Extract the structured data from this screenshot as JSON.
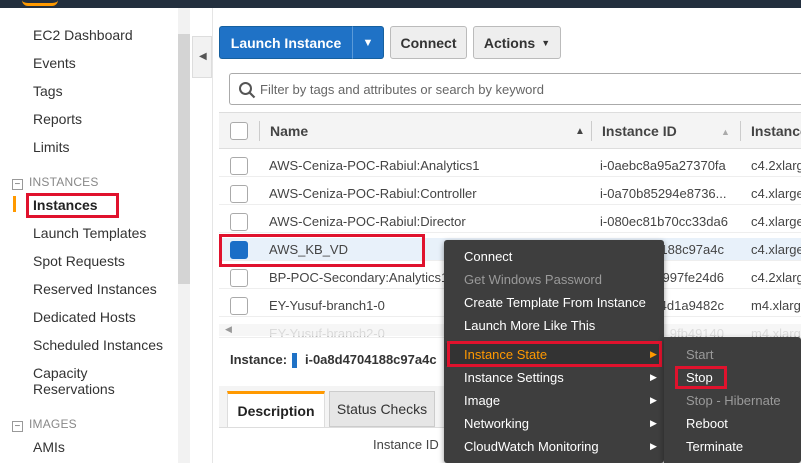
{
  "sidebar": {
    "items_top": [
      "EC2 Dashboard",
      "Events",
      "Tags",
      "Reports",
      "Limits"
    ],
    "section_instances": "INSTANCES",
    "instances_items": [
      "Instances",
      "Launch Templates",
      "Spot Requests",
      "Reserved Instances",
      "Dedicated Hosts",
      "Scheduled Instances",
      "Capacity",
      "Reservations"
    ],
    "section_images": "IMAGES",
    "images_items": [
      "AMIs"
    ],
    "collapse_glyph": "−"
  },
  "toolbar": {
    "launch_label": "Launch Instance",
    "connect_label": "Connect",
    "actions_label": "Actions"
  },
  "search": {
    "placeholder": "Filter by tags and attributes or search by keyword"
  },
  "table": {
    "columns": [
      "Name",
      "Instance ID",
      "Instance"
    ],
    "rows": [
      {
        "name": "AWS-Ceniza-POC-Rabiul:Analytics1",
        "id": "i-0aebc8a95a27370fa",
        "type": "c4.2xlarg"
      },
      {
        "name": "AWS-Ceniza-POC-Rabiul:Controller",
        "id": "i-0a70b85294e8736...",
        "type": "c4.xlarge"
      },
      {
        "name": "AWS-Ceniza-POC-Rabiul:Director",
        "id": "i-080ec81b70cc33da6",
        "type": "c4.xlarge"
      },
      {
        "name": "AWS_KB_VD",
        "id": "188c97a4c",
        "type": "c4.xlarge"
      },
      {
        "name": "BP-POC-Secondary:Analytics1",
        "id": "997fe24d6",
        "type": "c4.2xlarg"
      },
      {
        "name": "EY-Yusuf-branch1-0",
        "id": "4d1a9482c",
        "type": "m4.xlarg"
      },
      {
        "name": "EY-Yusuf-branch2-0",
        "id": "9fb49140",
        "type": "m4.xlarg"
      }
    ]
  },
  "details": {
    "instance_label": "Instance:",
    "instance_id": "i-0a8d4704188c97a4c",
    "tabs": [
      "Description",
      "Status Checks"
    ],
    "field_label": "Instance ID"
  },
  "context_menu": {
    "items": [
      "Connect",
      "Get Windows Password",
      "Create Template From Instance",
      "Launch More Like This",
      "Instance State",
      "Instance Settings",
      "Image",
      "Networking",
      "CloudWatch Monitoring"
    ],
    "arrow": "▶"
  },
  "submenu": {
    "items": [
      "Start",
      "Stop",
      "Stop - Hibernate",
      "Reboot",
      "Terminate"
    ]
  },
  "colors": {
    "primary": "#1f72c6",
    "accent": "#ff9900",
    "highlight": "#e0122d",
    "menu_bg": "#3e3e3e"
  }
}
